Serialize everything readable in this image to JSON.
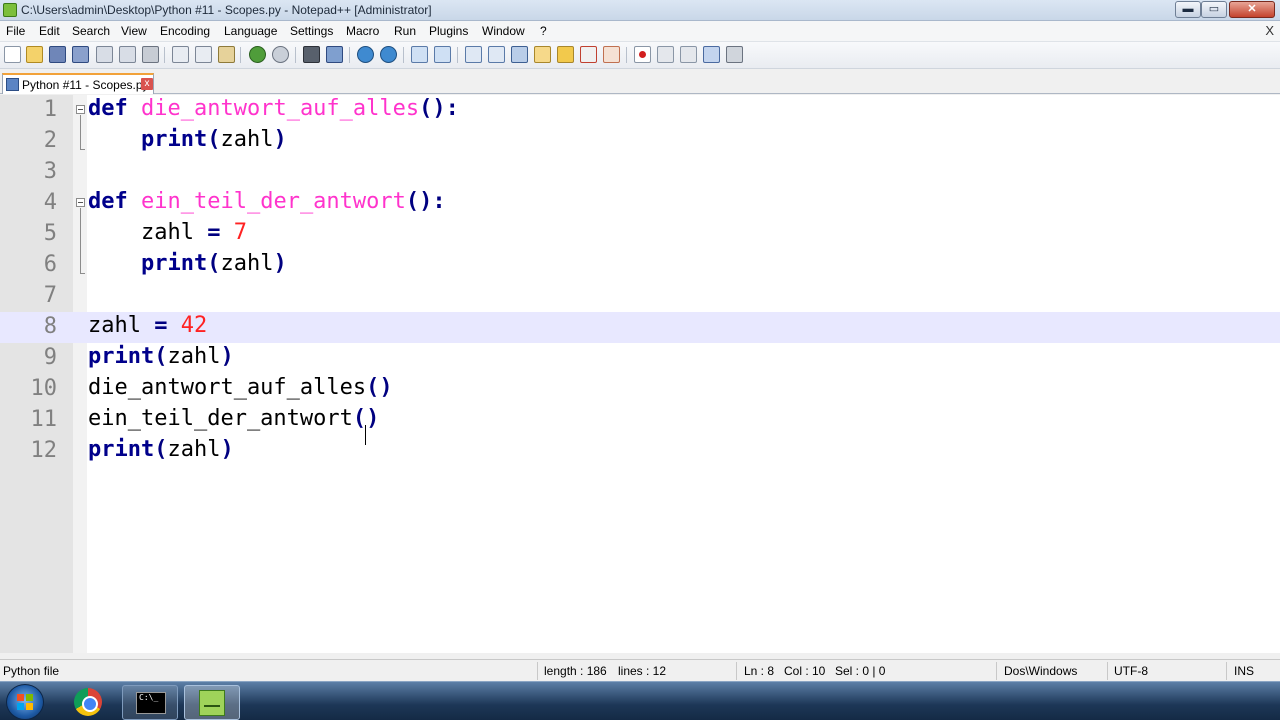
{
  "window": {
    "title": "C:\\Users\\admin\\Desktop\\Python #11 - Scopes.py - Notepad++ [Administrator]",
    "minimize": "▬",
    "maximize": "▭",
    "close": "✕"
  },
  "menu": {
    "items": [
      "File",
      "Edit",
      "Search",
      "View",
      "Encoding",
      "Language",
      "Settings",
      "Macro",
      "Run",
      "Plugins",
      "Window",
      "?"
    ],
    "close_doc": "X"
  },
  "toolbar": {
    "icons": [
      "new-file-icon",
      "open-file-icon",
      "save-icon",
      "save-all-icon",
      "close-icon",
      "close-all-icon",
      "print-icon",
      "cut-icon",
      "copy-icon",
      "paste-icon",
      "undo-icon",
      "redo-icon",
      "find-icon",
      "replace-icon",
      "zoom-in-icon",
      "zoom-out-icon",
      "sync-vertical-icon",
      "sync-horizontal-icon",
      "word-wrap-icon",
      "show-all-chars-icon",
      "indent-guide-icon",
      "document-map-icon",
      "function-list-icon",
      "folder-workspace-icon",
      "monitoring-icon",
      "record-macro-icon",
      "stop-macro-icon",
      "play-macro-icon",
      "run-macro-multiple-icon",
      "save-macro-icon"
    ]
  },
  "tab": {
    "label": "Python #11 - Scopes.py",
    "close": "x"
  },
  "editor": {
    "current_line": 8,
    "lines": [
      {
        "num": "1",
        "tokens": [
          {
            "t": "def",
            "c": "kw"
          },
          {
            "t": " "
          },
          {
            "t": "die_antwort_auf_alles",
            "c": "fn"
          },
          {
            "t": "():",
            "c": "op"
          }
        ]
      },
      {
        "num": "2",
        "tokens": [
          {
            "t": "    "
          },
          {
            "t": "print",
            "c": "kw"
          },
          {
            "t": "(",
            "c": "op"
          },
          {
            "t": "zahl"
          },
          {
            "t": ")",
            "c": "op"
          }
        ]
      },
      {
        "num": "3",
        "tokens": []
      },
      {
        "num": "4",
        "tokens": [
          {
            "t": "def",
            "c": "kw"
          },
          {
            "t": " "
          },
          {
            "t": "ein_teil_der_antwort",
            "c": "fn"
          },
          {
            "t": "():",
            "c": "op"
          }
        ]
      },
      {
        "num": "5",
        "tokens": [
          {
            "t": "    zahl "
          },
          {
            "t": "=",
            "c": "op"
          },
          {
            "t": " "
          },
          {
            "t": "7",
            "c": "num"
          }
        ]
      },
      {
        "num": "6",
        "tokens": [
          {
            "t": "    "
          },
          {
            "t": "print",
            "c": "kw"
          },
          {
            "t": "(",
            "c": "op"
          },
          {
            "t": "zahl"
          },
          {
            "t": ")",
            "c": "op"
          }
        ]
      },
      {
        "num": "7",
        "tokens": []
      },
      {
        "num": "8",
        "tokens": [
          {
            "t": "zahl "
          },
          {
            "t": "=",
            "c": "op"
          },
          {
            "t": " "
          },
          {
            "t": "42",
            "c": "num"
          }
        ]
      },
      {
        "num": "9",
        "tokens": [
          {
            "t": "print",
            "c": "kw"
          },
          {
            "t": "(",
            "c": "op"
          },
          {
            "t": "zahl"
          },
          {
            "t": ")",
            "c": "op"
          }
        ]
      },
      {
        "num": "10",
        "tokens": [
          {
            "t": "die_antwort_auf_alles"
          },
          {
            "t": "()",
            "c": "op"
          }
        ]
      },
      {
        "num": "11",
        "tokens": [
          {
            "t": "ein_teil_der_antwort"
          },
          {
            "t": "()",
            "c": "op"
          }
        ]
      },
      {
        "num": "12",
        "tokens": [
          {
            "t": "print",
            "c": "kw"
          },
          {
            "t": "(",
            "c": "op"
          },
          {
            "t": "zahl"
          },
          {
            "t": ")",
            "c": "op"
          }
        ]
      }
    ]
  },
  "status": {
    "file_type": "Python file",
    "length": "length : 186",
    "lines": "lines : 12",
    "ln": "Ln : 8",
    "col": "Col : 10",
    "sel": "Sel : 0 | 0",
    "eol": "Dos\\Windows",
    "encoding": "UTF-8",
    "mode": "INS"
  },
  "taskbar": {
    "cmd_prompt": "C:\\_",
    "items": [
      "start-button",
      "chrome",
      "command-prompt",
      "notepad-plus-plus"
    ]
  },
  "colors": {
    "keyword": "#00008b",
    "function_name": "#ff33cc",
    "number": "#ff2222",
    "operator": "#000080",
    "current_line": "#e8e8ff",
    "tab_accent": "#f2a23a"
  }
}
